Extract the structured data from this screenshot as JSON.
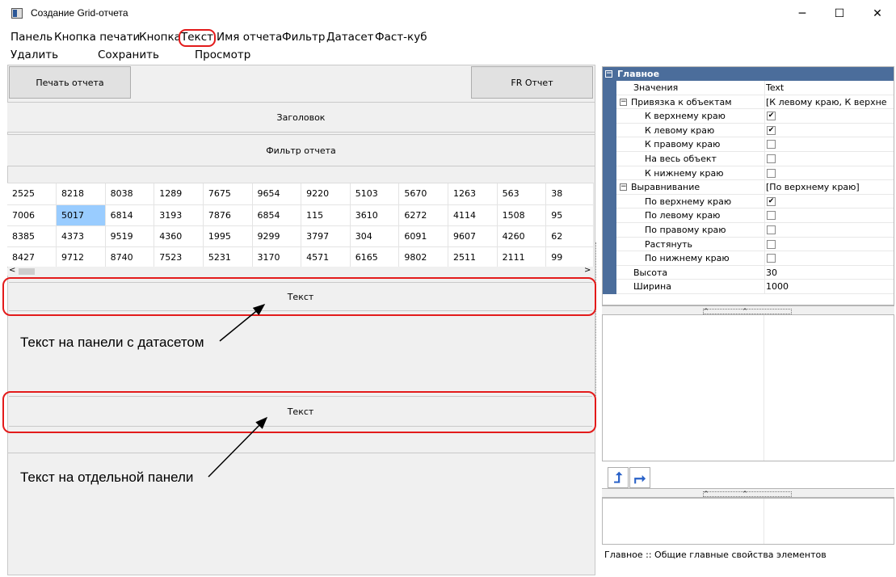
{
  "window": {
    "title": "Создание Grid-отчета",
    "minimize": "─",
    "maximize": "☐",
    "close": "✕"
  },
  "menu": [
    {
      "label": "Панель"
    },
    {
      "label": "Кнопка печати"
    },
    {
      "label": "Кнопка"
    },
    {
      "label": "Текст"
    },
    {
      "label": "Имя отчета"
    },
    {
      "label": "Фильтр"
    },
    {
      "label": "Датасет"
    },
    {
      "label": "Фаст-куб"
    }
  ],
  "toolbar": {
    "delete": "Удалить",
    "save": "Сохранить",
    "preview": "Просмотр"
  },
  "designer": {
    "print_button": "Печать отчета",
    "fr_button": "FR Отчет",
    "header_bar": "Заголовок",
    "filter_bar": "Фильтр отчета",
    "text_bar_1": "Текст",
    "text_bar_2": "Текст"
  },
  "grid": {
    "rows": [
      [
        "2525",
        "8218",
        "8038",
        "1289",
        "7675",
        "9654",
        "9220",
        "5103",
        "5670",
        "1263",
        "563",
        "38"
      ],
      [
        "7006",
        "5017",
        "6814",
        "3193",
        "7876",
        "6854",
        "115",
        "3610",
        "6272",
        "4114",
        "1508",
        "95"
      ],
      [
        "8385",
        "4373",
        "9519",
        "4360",
        "1995",
        "9299",
        "3797",
        "304",
        "6091",
        "9607",
        "4260",
        "62"
      ],
      [
        "8427",
        "9712",
        "8740",
        "7523",
        "5231",
        "3170",
        "4571",
        "6165",
        "9802",
        "2511",
        "2111",
        "99"
      ]
    ],
    "selected": {
      "row": 1,
      "col": 1
    },
    "scroll_left": "<",
    "scroll_right": ">"
  },
  "annotations": {
    "dataset_panel": "Текст на панели с датасетом",
    "separate_panel": "Текст на отдельной панели"
  },
  "properties": {
    "section": "Главное",
    "rows": [
      {
        "name": "Значения",
        "value": "Text",
        "level": 1,
        "type": "text"
      },
      {
        "name": "Привязка к объектам",
        "value": "[К левому краю, К верхне",
        "level": 0,
        "type": "group",
        "expander": "−"
      },
      {
        "name": "К верхнему краю",
        "value": "✔",
        "level": 2,
        "type": "check"
      },
      {
        "name": "К левому краю",
        "value": "✔",
        "level": 2,
        "type": "check"
      },
      {
        "name": "К правому краю",
        "value": "",
        "level": 2,
        "type": "check"
      },
      {
        "name": "На весь объект",
        "value": "",
        "level": 2,
        "type": "check"
      },
      {
        "name": "К нижнему краю",
        "value": "",
        "level": 2,
        "type": "check"
      },
      {
        "name": "Выравнивание",
        "value": "[По верхнему краю]",
        "level": 0,
        "type": "group",
        "expander": "−"
      },
      {
        "name": "По верхнему краю",
        "value": "✔",
        "level": 2,
        "type": "check"
      },
      {
        "name": "По левому краю",
        "value": "",
        "level": 2,
        "type": "check"
      },
      {
        "name": "По правому краю",
        "value": "",
        "level": 2,
        "type": "check"
      },
      {
        "name": "Растянуть",
        "value": "",
        "level": 2,
        "type": "check"
      },
      {
        "name": "По нижнему краю",
        "value": "",
        "level": 2,
        "type": "check"
      },
      {
        "name": "Высота",
        "value": "30",
        "level": 1,
        "type": "text"
      },
      {
        "name": "Ширина",
        "value": "1000",
        "level": 1,
        "type": "text"
      }
    ],
    "up_button": "⮥",
    "down_button": "⮣",
    "status": "Главное :: Общие главные свойства элементов"
  },
  "colors": {
    "highlight": "#e31b1b",
    "selection": "#99ccff",
    "property_gutter": "#4b6d9b"
  }
}
